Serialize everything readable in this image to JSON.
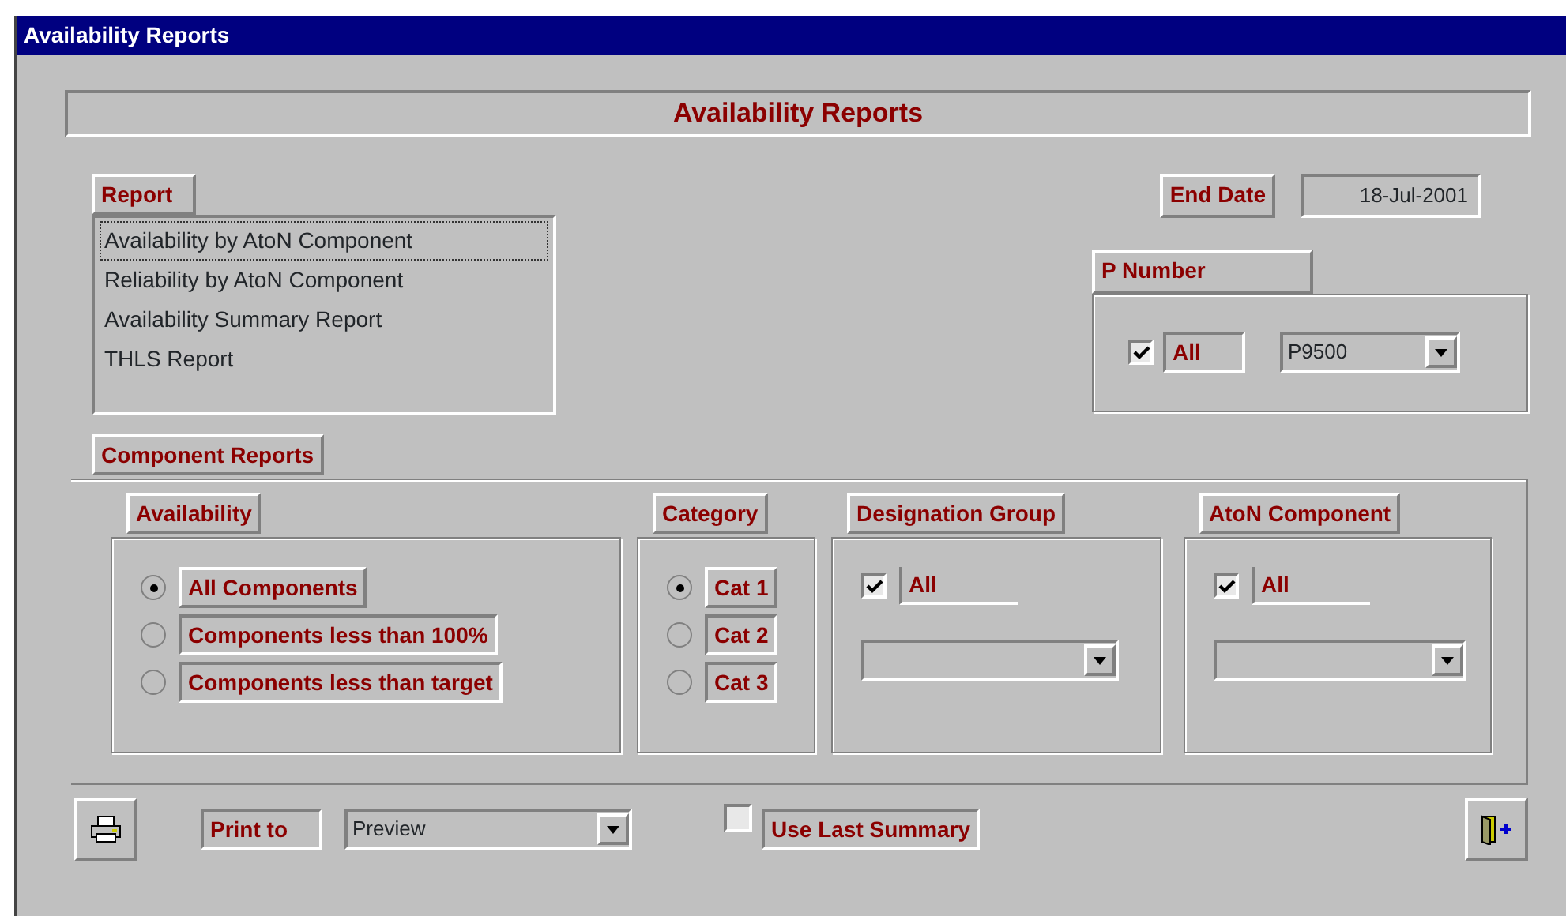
{
  "window": {
    "title": "Availability Reports"
  },
  "header": {
    "title": "Availability Reports"
  },
  "report": {
    "label": "Report",
    "items": [
      {
        "text": "Availability by AtoN Component",
        "selected": true
      },
      {
        "text": "Reliability by AtoN Component",
        "selected": false
      },
      {
        "text": "Availability Summary Report",
        "selected": false
      },
      {
        "text": "THLS Report",
        "selected": false
      }
    ]
  },
  "end_date": {
    "label": "End Date",
    "value": "18-Jul-2001"
  },
  "p_number": {
    "label": "P Number",
    "all_label": "All",
    "all_checked": true,
    "value": "P9500"
  },
  "component_reports": {
    "tab_label": "Component Reports",
    "availability": {
      "label": "Availability",
      "options": [
        {
          "text": "All Components",
          "selected": true
        },
        {
          "text": "Components less than 100%",
          "selected": false
        },
        {
          "text": "Components less than target",
          "selected": false
        }
      ]
    },
    "category": {
      "label": "Category",
      "options": [
        {
          "text": "Cat 1",
          "selected": true
        },
        {
          "text": "Cat 2",
          "selected": false
        },
        {
          "text": "Cat 3",
          "selected": false
        }
      ]
    },
    "designation_group": {
      "label": "Designation Group",
      "all_label": "All",
      "all_checked": true
    },
    "aton_component": {
      "label": "AtoN Component",
      "all_label": "All",
      "all_checked": true
    }
  },
  "footer": {
    "print_to_label": "Print to",
    "print_to_value": "Preview",
    "use_last_summary": {
      "label": "Use Last Summary",
      "checked": false
    }
  }
}
